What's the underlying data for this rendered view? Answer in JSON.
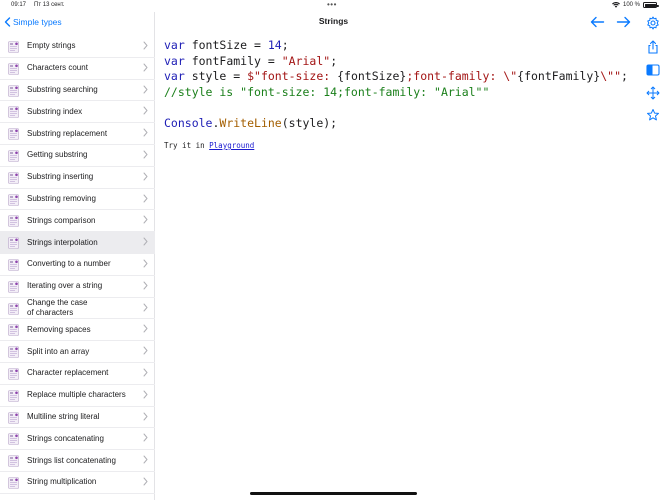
{
  "status_bar": {
    "time": "09:17",
    "date": "Пт 13 сент.",
    "battery": "100 %",
    "dots": "•••"
  },
  "sidebar": {
    "back_label": "Simple types",
    "items": [
      {
        "label": "Empty strings",
        "selected": false
      },
      {
        "label": "Characters count",
        "selected": false
      },
      {
        "label": "Substring searching",
        "selected": false
      },
      {
        "label": "Substring index",
        "selected": false
      },
      {
        "label": "Substring replacement",
        "selected": false
      },
      {
        "label": "Getting substring",
        "selected": false
      },
      {
        "label": "Substring inserting",
        "selected": false
      },
      {
        "label": "Substring removing",
        "selected": false
      },
      {
        "label": "Strings comparison",
        "selected": false
      },
      {
        "label": "Strings interpolation",
        "selected": true
      },
      {
        "label": "Converting to a number",
        "selected": false
      },
      {
        "label": "Iterating over a string",
        "selected": false
      },
      {
        "label": "Change the case\nof characters",
        "selected": false
      },
      {
        "label": "Removing spaces",
        "selected": false
      },
      {
        "label": "Split into an array",
        "selected": false
      },
      {
        "label": "Character replacement",
        "selected": false
      },
      {
        "label": "Replace multiple characters",
        "selected": false
      },
      {
        "label": "Multiline string literal",
        "selected": false
      },
      {
        "label": "Strings concatenating",
        "selected": false
      },
      {
        "label": "Strings list concatenating",
        "selected": false
      },
      {
        "label": "String multiplication",
        "selected": false
      }
    ]
  },
  "nav": {
    "title": "Strings"
  },
  "code": {
    "line1": {
      "kw": "var",
      "name": " fontSize = ",
      "val": "14",
      "end": ";"
    },
    "line2": {
      "kw": "var",
      "name": " fontFamily = ",
      "val": "\"Arial\"",
      "end": ";"
    },
    "line3": {
      "kw": "var",
      "name": " style = ",
      "val": "$\"font-size: ",
      "i1": "{fontSize}",
      "mid": ";font-family: \\\"",
      "i2": "{fontFamily}",
      "tail": "\\\"\"",
      "end": ";"
    },
    "line4": "//style is \"font-size: 14;font-family: \"Arial\"\"",
    "line6": {
      "type": "Console",
      "dot": ".",
      "method": "WriteLine",
      "args": "(style);"
    }
  },
  "try": {
    "prefix": "Try it in ",
    "link": "Playground"
  },
  "colors": {
    "accent": "#0a7aff",
    "keyword": "#1d1db5",
    "string": "#a31515",
    "comment": "#1a7f1a",
    "selected_row": "#ececef"
  },
  "icons": {
    "back": "chevron-left-icon",
    "nav_back": "arrow-left-icon",
    "nav_forward": "arrow-right-icon",
    "settings": "gear-icon",
    "share": "share-icon",
    "sidebar_toggle": "sidebar-icon",
    "move": "move-arrows-icon",
    "favorite": "star-icon"
  }
}
